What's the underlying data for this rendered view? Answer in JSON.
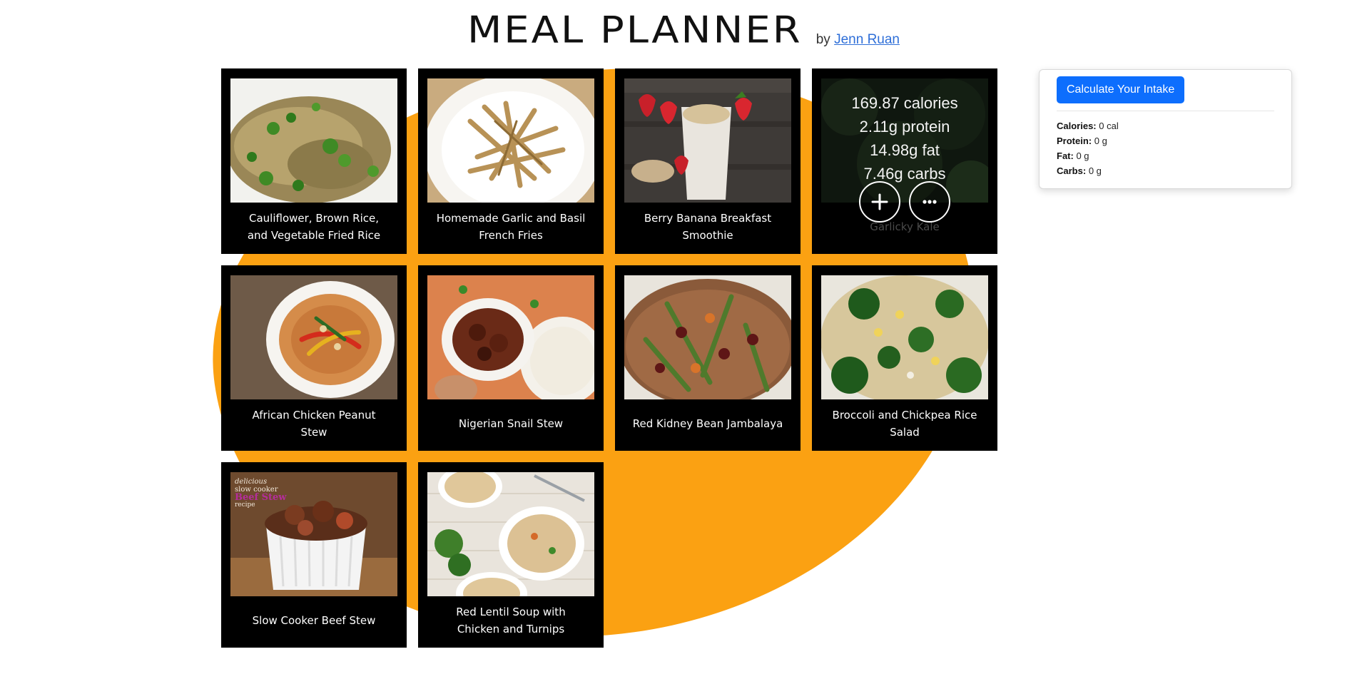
{
  "header": {
    "title": "MEAL PLANNER",
    "by_prefix": "by",
    "author": "Jenn Ruan"
  },
  "colors": {
    "backdrop": "#fba112",
    "card": "#000000",
    "button": "#0d6efd",
    "link": "#2f6fd8"
  },
  "meals": [
    {
      "title": "Cauliflower, Brown Rice, and Vegetable Fried Rice",
      "image_icon": "fried-rice-photo"
    },
    {
      "title": "Homemade Garlic and Basil French Fries",
      "image_icon": "french-fries-photo"
    },
    {
      "title": "Berry Banana Breakfast Smoothie",
      "image_icon": "smoothie-photo"
    },
    {
      "title": "Garlicky Kale",
      "image_icon": "kale-photo",
      "hover": {
        "calories": "169.87 calories",
        "protein": "2.11g protein",
        "fat": "14.98g fat",
        "carbs": "7.46g carbs"
      }
    },
    {
      "title": "African Chicken Peanut Stew",
      "image_icon": "peanut-stew-photo"
    },
    {
      "title": "Nigerian Snail Stew",
      "image_icon": "snail-stew-photo"
    },
    {
      "title": "Red Kidney Bean Jambalaya",
      "image_icon": "jambalaya-photo"
    },
    {
      "title": "Broccoli and Chickpea Rice Salad",
      "image_icon": "broccoli-salad-photo"
    },
    {
      "title": "Slow Cooker Beef Stew",
      "image_icon": "beef-stew-photo",
      "image_text": {
        "line1": "delicious",
        "line2": "slow cooker",
        "line3": "Beef Stew",
        "line4": "recipe"
      }
    },
    {
      "title": "Red Lentil Soup with Chicken and Turnips",
      "image_icon": "lentil-soup-photo"
    }
  ],
  "overlay_actions": {
    "add_icon": "plus-icon",
    "more_icon": "more-dots-icon"
  },
  "intake": {
    "button_label": "Calculate Your Intake",
    "calories_label": "Calories:",
    "calories_value": "0 cal",
    "protein_label": "Protein:",
    "protein_value": "0 g",
    "fat_label": "Fat:",
    "fat_value": "0 g",
    "carbs_label": "Carbs:",
    "carbs_value": "0 g"
  }
}
